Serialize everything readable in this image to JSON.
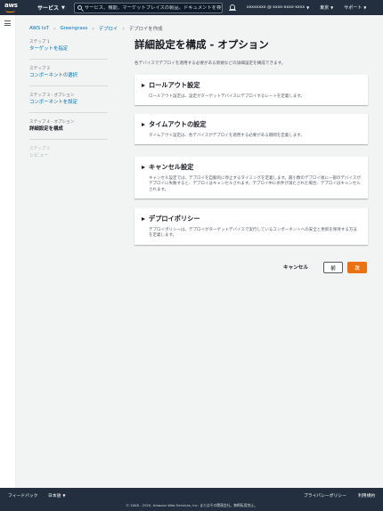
{
  "topnav": {
    "logo_text": "aws",
    "services_label": "サービス",
    "search_placeholder": "サービス、機能、マーケットプレイスの製品、ドキュメントを検索",
    "search_shortcut": "[Option+S]",
    "account": "xxxxxxxx @ xxxx-xxxx-xxxx",
    "region": "東京",
    "support": "サポート"
  },
  "breadcrumb": {
    "items": [
      "AWS IoT",
      "Greengrass",
      "デプロイ"
    ],
    "current": "デプロイを作成"
  },
  "steps": [
    {
      "num": "ステップ 1",
      "name": "ターゲットを指定",
      "state": "link"
    },
    {
      "num": "ステップ 2",
      "name": "コンポーネントの選択",
      "state": "link"
    },
    {
      "num": "ステップ 3 - オプション",
      "name": "コンポーネントを設定",
      "state": "link"
    },
    {
      "num": "ステップ 4 - オプション",
      "name": "詳細設定を構成",
      "state": "current"
    },
    {
      "num": "ステップ 5",
      "name": "レビュー",
      "state": "disabled"
    }
  ],
  "main": {
    "title": "詳細設定を構成 - オプション",
    "subtitle": "各デバイスでデプロイを適用する必要がある新規などの詳細設定を構成できます。",
    "cards": [
      {
        "title": "ロールアウト設定",
        "desc": "ロールアウト設定は、設定がターゲットデバイスにデプロイするレートを定義します。"
      },
      {
        "title": "タイムアウトの設定",
        "desc": "タイムアウト設定は、各デバイスがデプロイを適用する必要がある期間を定義します。"
      },
      {
        "title": "キャンセル設定",
        "desc": "キャンセル設定では、デプロイを自動的に停止するタイミングを定義します。最小数のデプロイ後に一部のデバイスがデプロイに失敗すると、デプロイはキャンセルされます。デプロイ中に条件が満たされた場合、デプロイはキャンセルされます。"
      },
      {
        "title": "デプロイポリシー",
        "desc": "デプロイポリシーは、デプロイがターゲットデバイスで実行しているコンポーネントへの安全と更新を保持する方法を定義します。"
      }
    ]
  },
  "actions": {
    "cancel": "キャンセル",
    "previous": "前",
    "next": "次"
  },
  "footer": {
    "feedback": "フィードバック",
    "language": "日本語",
    "privacy": "プライバシーポリシー",
    "terms": "利用規約",
    "copyright": "© 2008 - 2020, Amazon Web Services, Inc. またはその関連会社。無断転用禁止。"
  },
  "colors": {
    "nav_bg": "#232f3e",
    "link": "#0073bb",
    "primary": "#ec7211",
    "page_bg": "#f2f3f3"
  }
}
